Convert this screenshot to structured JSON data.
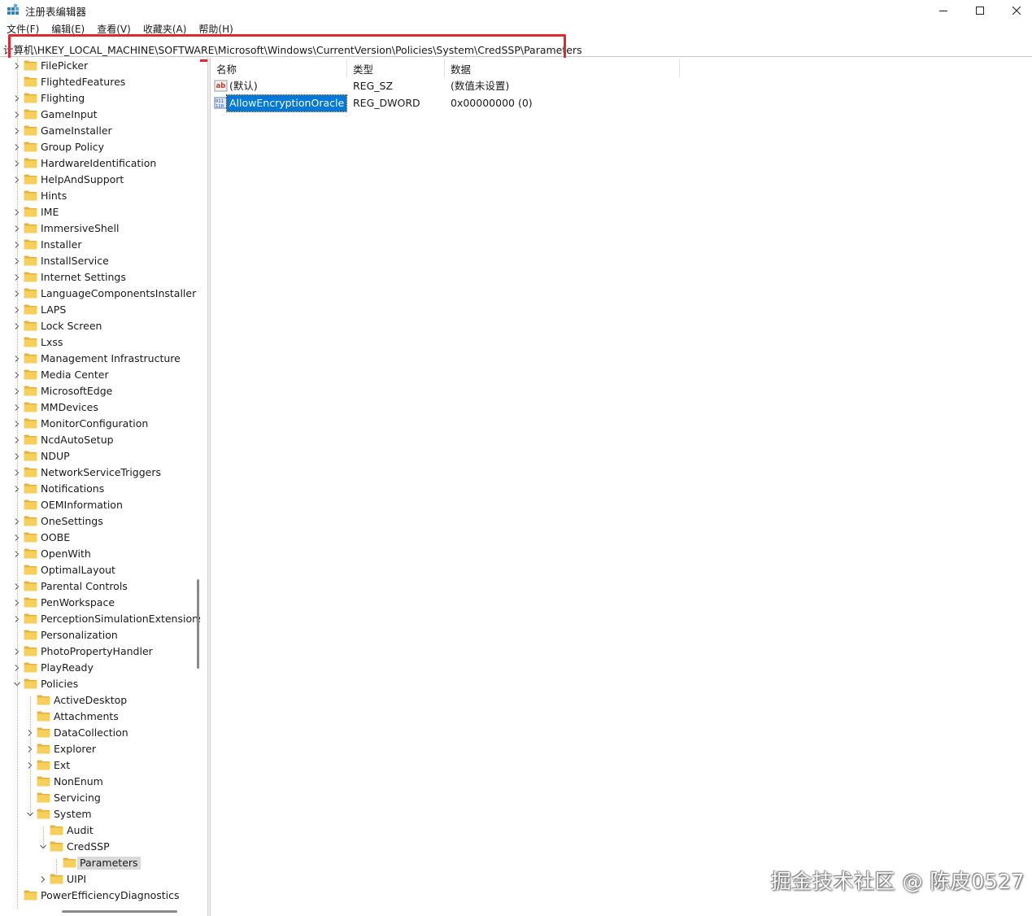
{
  "window": {
    "title": "注册表编辑器"
  },
  "menu": [
    "文件(F)",
    "编辑(E)",
    "查看(V)",
    "收藏夹(A)",
    "帮助(H)"
  ],
  "address": "计算机\\HKEY_LOCAL_MACHINE\\SOFTWARE\\Microsoft\\Windows\\CurrentVersion\\Policies\\System\\CredSSP\\Parameters",
  "tree": [
    {
      "label": "FilePicker",
      "depth": 0,
      "expander": "collapsed"
    },
    {
      "label": "FlightedFeatures",
      "depth": 0,
      "expander": "none"
    },
    {
      "label": "Flighting",
      "depth": 0,
      "expander": "collapsed"
    },
    {
      "label": "GameInput",
      "depth": 0,
      "expander": "collapsed"
    },
    {
      "label": "GameInstaller",
      "depth": 0,
      "expander": "collapsed"
    },
    {
      "label": "Group Policy",
      "depth": 0,
      "expander": "collapsed"
    },
    {
      "label": "HardwareIdentification",
      "depth": 0,
      "expander": "collapsed"
    },
    {
      "label": "HelpAndSupport",
      "depth": 0,
      "expander": "collapsed"
    },
    {
      "label": "Hints",
      "depth": 0,
      "expander": "none"
    },
    {
      "label": "IME",
      "depth": 0,
      "expander": "collapsed"
    },
    {
      "label": "ImmersiveShell",
      "depth": 0,
      "expander": "collapsed"
    },
    {
      "label": "Installer",
      "depth": 0,
      "expander": "collapsed"
    },
    {
      "label": "InstallService",
      "depth": 0,
      "expander": "collapsed"
    },
    {
      "label": "Internet Settings",
      "depth": 0,
      "expander": "collapsed"
    },
    {
      "label": "LanguageComponentsInstaller",
      "depth": 0,
      "expander": "collapsed"
    },
    {
      "label": "LAPS",
      "depth": 0,
      "expander": "collapsed"
    },
    {
      "label": "Lock Screen",
      "depth": 0,
      "expander": "collapsed"
    },
    {
      "label": "Lxss",
      "depth": 0,
      "expander": "none"
    },
    {
      "label": "Management Infrastructure",
      "depth": 0,
      "expander": "collapsed"
    },
    {
      "label": "Media Center",
      "depth": 0,
      "expander": "collapsed"
    },
    {
      "label": "MicrosoftEdge",
      "depth": 0,
      "expander": "collapsed"
    },
    {
      "label": "MMDevices",
      "depth": 0,
      "expander": "collapsed"
    },
    {
      "label": "MonitorConfiguration",
      "depth": 0,
      "expander": "collapsed"
    },
    {
      "label": "NcdAutoSetup",
      "depth": 0,
      "expander": "collapsed"
    },
    {
      "label": "NDUP",
      "depth": 0,
      "expander": "collapsed"
    },
    {
      "label": "NetworkServiceTriggers",
      "depth": 0,
      "expander": "collapsed"
    },
    {
      "label": "Notifications",
      "depth": 0,
      "expander": "collapsed"
    },
    {
      "label": "OEMInformation",
      "depth": 0,
      "expander": "none"
    },
    {
      "label": "OneSettings",
      "depth": 0,
      "expander": "collapsed"
    },
    {
      "label": "OOBE",
      "depth": 0,
      "expander": "collapsed"
    },
    {
      "label": "OpenWith",
      "depth": 0,
      "expander": "collapsed"
    },
    {
      "label": "OptimalLayout",
      "depth": 0,
      "expander": "none"
    },
    {
      "label": "Parental Controls",
      "depth": 0,
      "expander": "collapsed"
    },
    {
      "label": "PenWorkspace",
      "depth": 0,
      "expander": "collapsed"
    },
    {
      "label": "PerceptionSimulationExtensions",
      "depth": 0,
      "expander": "collapsed"
    },
    {
      "label": "Personalization",
      "depth": 0,
      "expander": "none"
    },
    {
      "label": "PhotoPropertyHandler",
      "depth": 0,
      "expander": "collapsed"
    },
    {
      "label": "PlayReady",
      "depth": 0,
      "expander": "collapsed"
    },
    {
      "label": "Policies",
      "depth": 0,
      "expander": "expanded"
    },
    {
      "label": "ActiveDesktop",
      "depth": 1,
      "expander": "none"
    },
    {
      "label": "Attachments",
      "depth": 1,
      "expander": "none"
    },
    {
      "label": "DataCollection",
      "depth": 1,
      "expander": "collapsed"
    },
    {
      "label": "Explorer",
      "depth": 1,
      "expander": "collapsed"
    },
    {
      "label": "Ext",
      "depth": 1,
      "expander": "collapsed"
    },
    {
      "label": "NonEnum",
      "depth": 1,
      "expander": "none"
    },
    {
      "label": "Servicing",
      "depth": 1,
      "expander": "none"
    },
    {
      "label": "System",
      "depth": 1,
      "expander": "expanded"
    },
    {
      "label": "Audit",
      "depth": 2,
      "expander": "none"
    },
    {
      "label": "CredSSP",
      "depth": 2,
      "expander": "expanded"
    },
    {
      "label": "Parameters",
      "depth": 3,
      "expander": "none",
      "selected": true
    },
    {
      "label": "UIPI",
      "depth": 2,
      "expander": "collapsed"
    },
    {
      "label": "PowerEfficiencyDiagnostics",
      "depth": 0,
      "expander": "none"
    }
  ],
  "list": {
    "columns": [
      "名称",
      "类型",
      "数据"
    ],
    "rows": [
      {
        "name": "(默认)",
        "type": "REG_SZ",
        "data": "(数值未设置)",
        "icon": "string-value-icon",
        "selected": false
      },
      {
        "name": "AllowEncryptionOracle",
        "type": "REG_DWORD",
        "data": "0x00000000 (0)",
        "icon": "binary-value-icon",
        "selected": true
      }
    ]
  },
  "watermark": "掘金技术社区 @ 陈皮0527",
  "colors": {
    "highlight_box": "#e0282e",
    "selection": "#0078d7",
    "folder": "#f4c84d"
  }
}
